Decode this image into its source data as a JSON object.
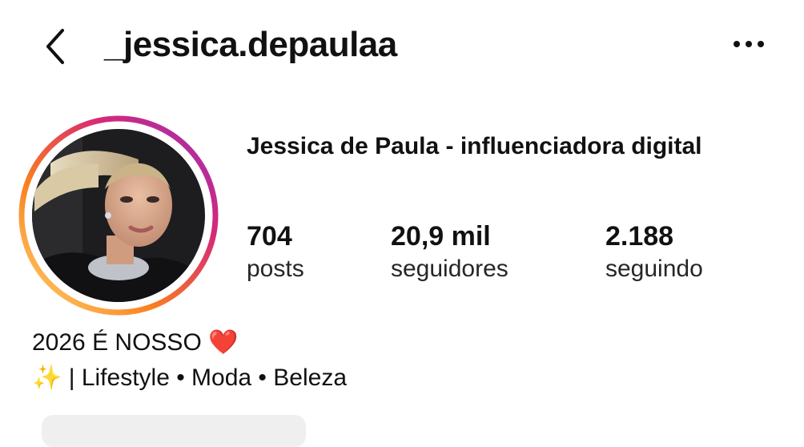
{
  "header": {
    "username": "_jessica.depaulaa",
    "back_icon": "chevron-left-icon",
    "more_icon": "ellipsis-icon"
  },
  "profile": {
    "display_name": "Jessica de Paula - influenciadora digital",
    "has_story_ring": true,
    "ring_colors": [
      "#FEDA75",
      "#FA7E1E",
      "#D62976",
      "#962FBF"
    ]
  },
  "stats": {
    "posts": {
      "value": "704",
      "label": "posts"
    },
    "followers": {
      "value": "20,9 mil",
      "label": "seguidores"
    },
    "following": {
      "value": "2.188",
      "label": "seguindo"
    }
  },
  "bio": {
    "line1_text": "2026 É NOSSO",
    "line1_emoji": "❤️",
    "line2_emoji": "✨",
    "line2_text": "| Lifestyle • Moda • Beleza"
  }
}
